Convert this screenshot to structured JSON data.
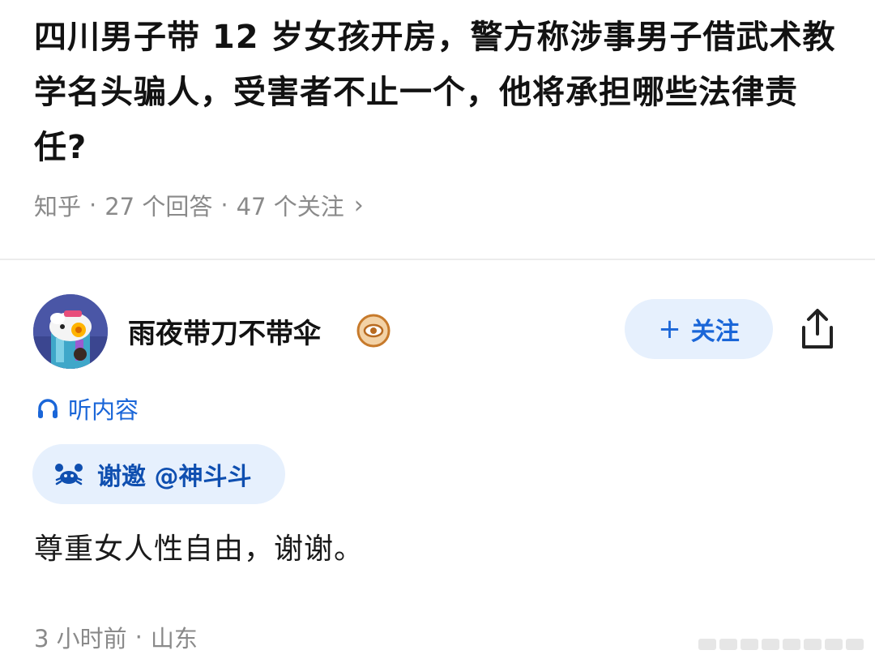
{
  "question": {
    "title": "四川男子带 12 岁女孩开房，警方称涉事男子借武术教学名头骗人，受害者不止一个，他将承担哪些法律责任?",
    "source": "知乎",
    "answers_count": "27 个回答",
    "followers_count": "47 个关注",
    "separator": "·",
    "chevron": "›"
  },
  "author": {
    "name": "雨夜带刀不带伞",
    "badge_icon": "eye-badge-icon",
    "avatar": "cartoon-avatar"
  },
  "actions": {
    "follow_plus": "+",
    "follow_label": "关注",
    "share_icon": "share-icon"
  },
  "listen": {
    "icon": "headphones-icon",
    "label": "听内容"
  },
  "invite": {
    "icon": "invite-crab-icon",
    "label": "谢邀 @神斗斗"
  },
  "answer": {
    "text": "尊重女人性自由，谢谢。",
    "time": "3 小时前",
    "separator": "·",
    "location": "山东"
  },
  "colors": {
    "accent": "#1a66d8",
    "chip_bg": "#e6f0fd",
    "meta_gray": "#8a8a8a",
    "text": "#121212"
  }
}
